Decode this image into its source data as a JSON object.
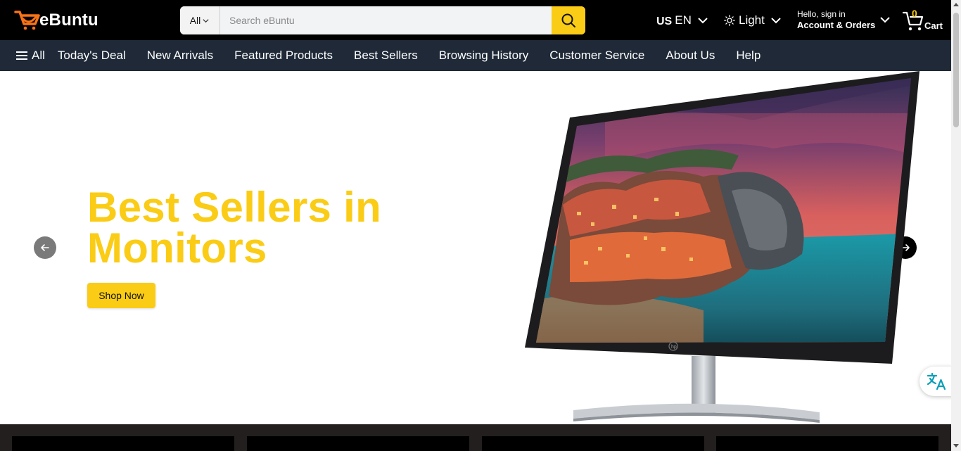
{
  "header": {
    "logo_text": "eBuntu",
    "search": {
      "category": "All",
      "placeholder": "Search eBuntu",
      "value": ""
    },
    "language": {
      "flag": "US",
      "code": "EN"
    },
    "theme": {
      "label": "Light"
    },
    "account": {
      "greeting": "Hello, sign in",
      "label": "Account & Orders"
    },
    "cart": {
      "count": "0",
      "label": "Cart"
    }
  },
  "nav": {
    "all_label": "All",
    "items": [
      "Today's Deal",
      "New Arrivals",
      "Featured Products",
      "Best Sellers",
      "Browsing History",
      "Customer Service",
      "About Us",
      "Help"
    ]
  },
  "hero": {
    "title_line1": "Best Sellers in",
    "title_line2": "Monitors",
    "cta_label": "Shop Now",
    "image": "monitor-product-image"
  },
  "colors": {
    "brand_yellow": "#facc15",
    "brand_orange": "#f97316",
    "nav_bg": "#1f2937",
    "header_bg": "#000000"
  },
  "icons": {
    "search": "search-icon",
    "theme": "sun-icon",
    "cart": "cart-icon",
    "menu": "hamburger-icon",
    "translate": "translate-icon"
  }
}
